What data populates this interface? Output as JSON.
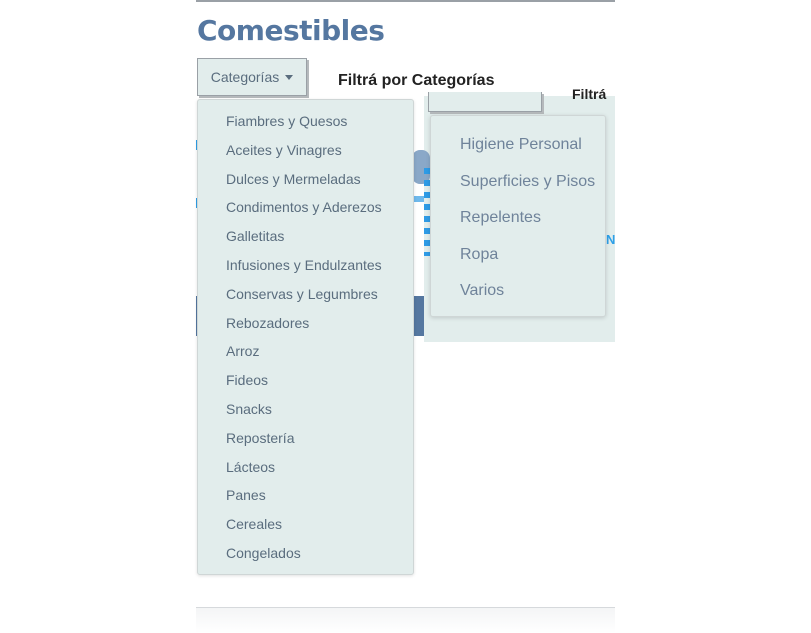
{
  "page": {
    "title": "Comestibles"
  },
  "filter": {
    "button_label": "Categorías",
    "label": "Filtrá por Categorías"
  },
  "background": {
    "partial_label": "Filtrá",
    "partial_letter": "N"
  },
  "categories_menu": {
    "items": [
      "Fiambres y Quesos",
      "Aceites y Vinagres",
      "Dulces y Mermeladas",
      "Condimentos y Aderezos",
      "Galletitas",
      "Infusiones y Endulzantes",
      "Conservas y Legumbres",
      "Rebozadores",
      "Arroz",
      "Fideos",
      "Snacks",
      "Repostería",
      "Lácteos",
      "Panes",
      "Cereales",
      "Congelados"
    ]
  },
  "secondary_menu": {
    "items": [
      "Higiene Personal",
      "Superficies y Pisos",
      "Repelentes",
      "Ropa",
      "Varios"
    ]
  }
}
